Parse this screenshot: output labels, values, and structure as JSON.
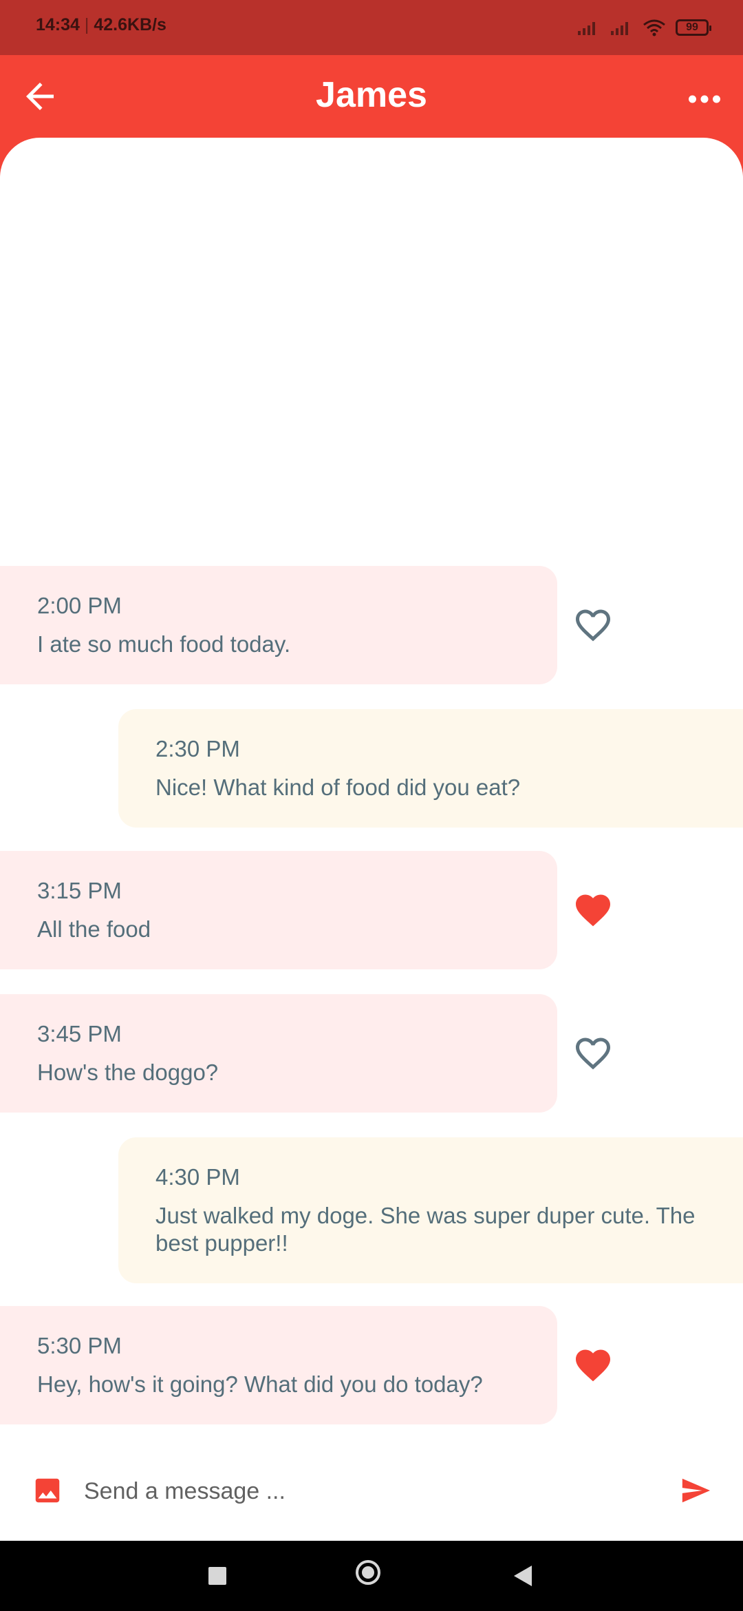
{
  "status_bar": {
    "time": "14:34",
    "net_speed": "42.6KB/s",
    "battery": "99"
  },
  "header": {
    "title": "James"
  },
  "messages": [
    {
      "direction": "in",
      "time": "2:00 PM",
      "text": "I ate so much food today.",
      "liked": false
    },
    {
      "direction": "out",
      "time": "2:30 PM",
      "text": "Nice! What kind of food did you eat?"
    },
    {
      "direction": "in",
      "time": "3:15 PM",
      "text": "All the food",
      "liked": true
    },
    {
      "direction": "in",
      "time": "3:45 PM",
      "text": "How's the doggo?",
      "liked": false
    },
    {
      "direction": "out",
      "time": "4:30 PM",
      "text": "Just walked my doge. She was super duper cute. The best pupper!!"
    },
    {
      "direction": "in",
      "time": "5:30 PM",
      "text": "Hey, how's it going? What did you do today?",
      "liked": true
    }
  ],
  "composer": {
    "placeholder": "Send a message ..."
  },
  "colors": {
    "primary": "#f44336",
    "status_bar": "#b8312b",
    "incoming_bubble": "#ffeded",
    "outgoing_bubble": "#fef8eb",
    "text": "#546e7a"
  },
  "icons": {
    "back": "arrow-back-icon",
    "more": "more-horiz-icon",
    "like": "heart-icon",
    "photo": "image-icon",
    "send": "send-icon"
  }
}
